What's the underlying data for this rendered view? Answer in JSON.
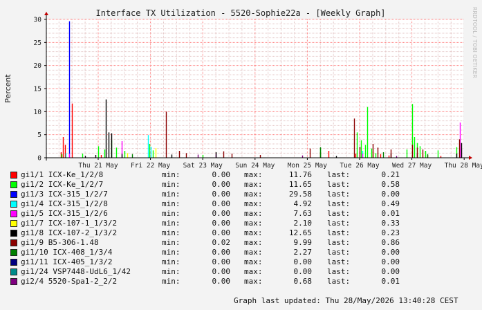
{
  "chart_data": {
    "type": "bar",
    "title": "Interface TX Utilization - 5520-Sophie22a - [Weekly Graph]",
    "ylabel": "Percent",
    "ylim": [
      0,
      30
    ],
    "yticks": [
      0,
      5,
      10,
      15,
      20,
      25,
      30
    ],
    "x_tick_labels": [
      "Thu 21 May",
      "Fri 22 May",
      "Sat 23 May",
      "Sun 24 May",
      "Mon 25 May",
      "Tue 26 May",
      "Wed 27 May",
      "Thu 28 May"
    ],
    "grid": true,
    "watermark": "RRDTOOL / TOBI OETIKER",
    "series": [
      {
        "name": "gi1/1 ICX-Ke_1/2/8",
        "color": "#ff0000",
        "min": "0.00",
        "max": "11.76",
        "last": "0.21",
        "spikes": [
          [
            -0.72,
            1.2
          ],
          [
            -0.68,
            4.5
          ],
          [
            -0.64,
            2.8
          ],
          [
            -0.5,
            11.76
          ],
          [
            0.05,
            0.6
          ],
          [
            4.4,
            1.5
          ],
          [
            4.92,
            0.9
          ],
          [
            5.4,
            0.8
          ],
          [
            5.55,
            0.5
          ],
          [
            6.3,
            0.6
          ],
          [
            6.55,
            0.4
          ]
        ]
      },
      {
        "name": "gi1/2 ICX-Ke_1/2/7",
        "color": "#00ff00",
        "min": "0.00",
        "max": "11.65",
        "last": "0.58",
        "spikes": [
          [
            -0.7,
            0.8
          ],
          [
            -0.3,
            0.9
          ],
          [
            0.0,
            2.5
          ],
          [
            0.12,
            1.8
          ],
          [
            0.25,
            3.8
          ],
          [
            0.35,
            2.2
          ],
          [
            0.5,
            1.5
          ],
          [
            0.98,
            3.0
          ],
          [
            1.05,
            1.6
          ],
          [
            2.0,
            0.6
          ],
          [
            4.25,
            2.2
          ],
          [
            4.95,
            5.5
          ],
          [
            5.02,
            3.8
          ],
          [
            5.1,
            2.8
          ],
          [
            5.15,
            11.0
          ],
          [
            5.22,
            2.0
          ],
          [
            5.3,
            1.0
          ],
          [
            5.9,
            1.8
          ],
          [
            6.0,
            11.65
          ],
          [
            6.05,
            4.5
          ],
          [
            6.1,
            3.2
          ],
          [
            6.15,
            2.5
          ],
          [
            6.25,
            1.5
          ],
          [
            6.5,
            1.6
          ],
          [
            6.85,
            2.3
          ]
        ]
      },
      {
        "name": "gi1/3 ICX-315_1/2/7",
        "color": "#0000ff",
        "min": "0.00",
        "max": "29.58",
        "last": "0.00",
        "spikes": [
          [
            -0.56,
            29.58
          ]
        ]
      },
      {
        "name": "gi1/4 ICX-315_1/2/8",
        "color": "#00ffff",
        "min": "0.00",
        "max": "4.92",
        "last": "0.49",
        "spikes": [
          [
            -0.62,
            1.0
          ],
          [
            0.95,
            4.92
          ],
          [
            1.0,
            2.4
          ],
          [
            5.05,
            1.5
          ]
        ]
      },
      {
        "name": "gi1/5 ICX-315_1/2/6",
        "color": "#ff00ff",
        "min": "0.00",
        "max": "7.63",
        "last": "0.01",
        "spikes": [
          [
            -0.55,
            0.9
          ],
          [
            0.45,
            3.6
          ],
          [
            2.25,
            0.8
          ],
          [
            5.05,
            0.9
          ],
          [
            6.92,
            7.63
          ],
          [
            6.95,
            2.0
          ]
        ]
      },
      {
        "name": "gi1/7 ICX-107-1_1/3/2",
        "color": "#ffff00",
        "min": "0.00",
        "max": "2.10",
        "last": "0.33",
        "spikes": [
          [
            0.55,
            1.0
          ],
          [
            1.1,
            2.1
          ],
          [
            5.25,
            1.2
          ],
          [
            6.2,
            1.0
          ]
        ]
      },
      {
        "name": "gi1/8 ICX-107-2_1/3/2",
        "color": "#000000",
        "min": "0.00",
        "max": "12.65",
        "last": "0.23",
        "spikes": [
          [
            -0.25,
            0.4
          ],
          [
            -0.05,
            0.6
          ],
          [
            0.15,
            12.65
          ],
          [
            0.2,
            5.5
          ],
          [
            0.25,
            5.3
          ],
          [
            0.45,
            0.8
          ],
          [
            1.4,
            0.7
          ],
          [
            2.25,
            1.2
          ],
          [
            4.55,
            0.4
          ],
          [
            5.6,
            1.0
          ],
          [
            6.1,
            1.0
          ],
          [
            6.85,
            0.9
          ],
          [
            6.95,
            3.2
          ]
        ]
      },
      {
        "name": "gi1/9 B5-306-1.48",
        "color": "#8b0000",
        "min": "0.02",
        "max": "9.99",
        "last": "0.86",
        "spikes": [
          [
            1.3,
            9.99
          ],
          [
            1.55,
            1.5
          ],
          [
            1.68,
            1.0
          ],
          [
            2.4,
            1.4
          ],
          [
            2.55,
            0.9
          ],
          [
            3.1,
            0.6
          ],
          [
            4.05,
            2.0
          ],
          [
            4.25,
            1.2
          ],
          [
            4.9,
            8.5
          ],
          [
            5.0,
            2.4
          ],
          [
            5.25,
            3.0
          ],
          [
            5.35,
            2.2
          ],
          [
            5.6,
            1.8
          ],
          [
            6.0,
            2.8
          ],
          [
            6.1,
            2.2
          ],
          [
            6.2,
            1.8
          ],
          [
            6.9,
            4.0
          ]
        ]
      },
      {
        "name": "gi1/10 ICX-408_1/3/4",
        "color": "#008000",
        "min": "0.00",
        "max": "2.27",
        "last": "0.00",
        "spikes": [
          [
            0.65,
            0.8
          ],
          [
            4.25,
            2.27
          ],
          [
            5.45,
            1.2
          ],
          [
            6.3,
            0.8
          ]
        ]
      },
      {
        "name": "gi1/11 ICX-405_1/3/2",
        "color": "#000080",
        "min": "0.00",
        "max": "0.00",
        "last": "0.00",
        "spikes": []
      },
      {
        "name": "gi1/24 VSP7448-UdL6_1/42",
        "color": "#008b8b",
        "min": "0.00",
        "max": "0.00",
        "last": "0.00",
        "spikes": []
      },
      {
        "name": "gi2/4 5520-Spa1-2_2/2",
        "color": "#800080",
        "min": "0.00",
        "max": "0.68",
        "last": "0.01",
        "spikes": [
          [
            1.9,
            0.68
          ],
          [
            3.9,
            0.5
          ],
          [
            5.7,
            0.4
          ]
        ]
      }
    ]
  },
  "legend_labels": {
    "min": "min:",
    "max": "max:",
    "last": "last:"
  },
  "footer": "Graph last updated: Thu 28/May/2026 13:40:28 CEST"
}
